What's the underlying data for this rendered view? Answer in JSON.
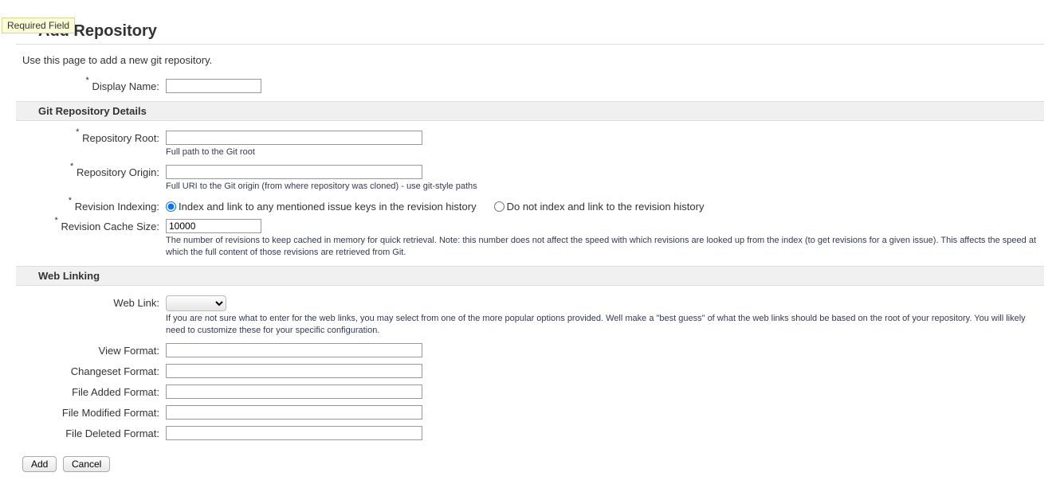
{
  "tooltip": "Required Field",
  "page_title": "Add Repository",
  "intro": "Use this page to add a new git repository.",
  "fields": {
    "display_name": {
      "label": "Display Name:",
      "value": ""
    },
    "repo_root": {
      "label": "Repository Root:",
      "value": "",
      "hint": "Full path to the Git root"
    },
    "repo_origin": {
      "label": "Repository Origin:",
      "value": "",
      "hint": "Full URI to the Git origin (from where repository was cloned) - use git-style paths"
    },
    "revision_indexing": {
      "label": "Revision Indexing:",
      "option_a": "Index and link to any mentioned issue keys in the revision history",
      "option_b": "Do not index and link to the revision history"
    },
    "revision_cache_size": {
      "label": "Revision Cache Size:",
      "value": "10000",
      "hint": "The number of revisions to keep cached in memory for quick retrieval. Note: this number does not affect the speed with which revisions are looked up from the index (to get revisions for a given issue). This affects the speed at which the full content of those revisions are retrieved from Git."
    },
    "web_link": {
      "label": "Web Link:",
      "hint": "If you are not sure what to enter for the web links, you may select from one of the more popular options provided. Well make a \"best guess\" of what the web links should be based on the root of your repository. You will likely need to customize these for your specific configuration."
    },
    "view_format": {
      "label": "View Format:",
      "value": ""
    },
    "changeset_format": {
      "label": "Changeset Format:",
      "value": ""
    },
    "file_added_format": {
      "label": "File Added Format:",
      "value": ""
    },
    "file_modified_format": {
      "label": "File Modified Format:",
      "value": ""
    },
    "file_deleted_format": {
      "label": "File Deleted Format:",
      "value": ""
    }
  },
  "sections": {
    "git_details": "Git Repository Details",
    "web_linking": "Web Linking"
  },
  "buttons": {
    "add": "Add",
    "cancel": "Cancel"
  }
}
